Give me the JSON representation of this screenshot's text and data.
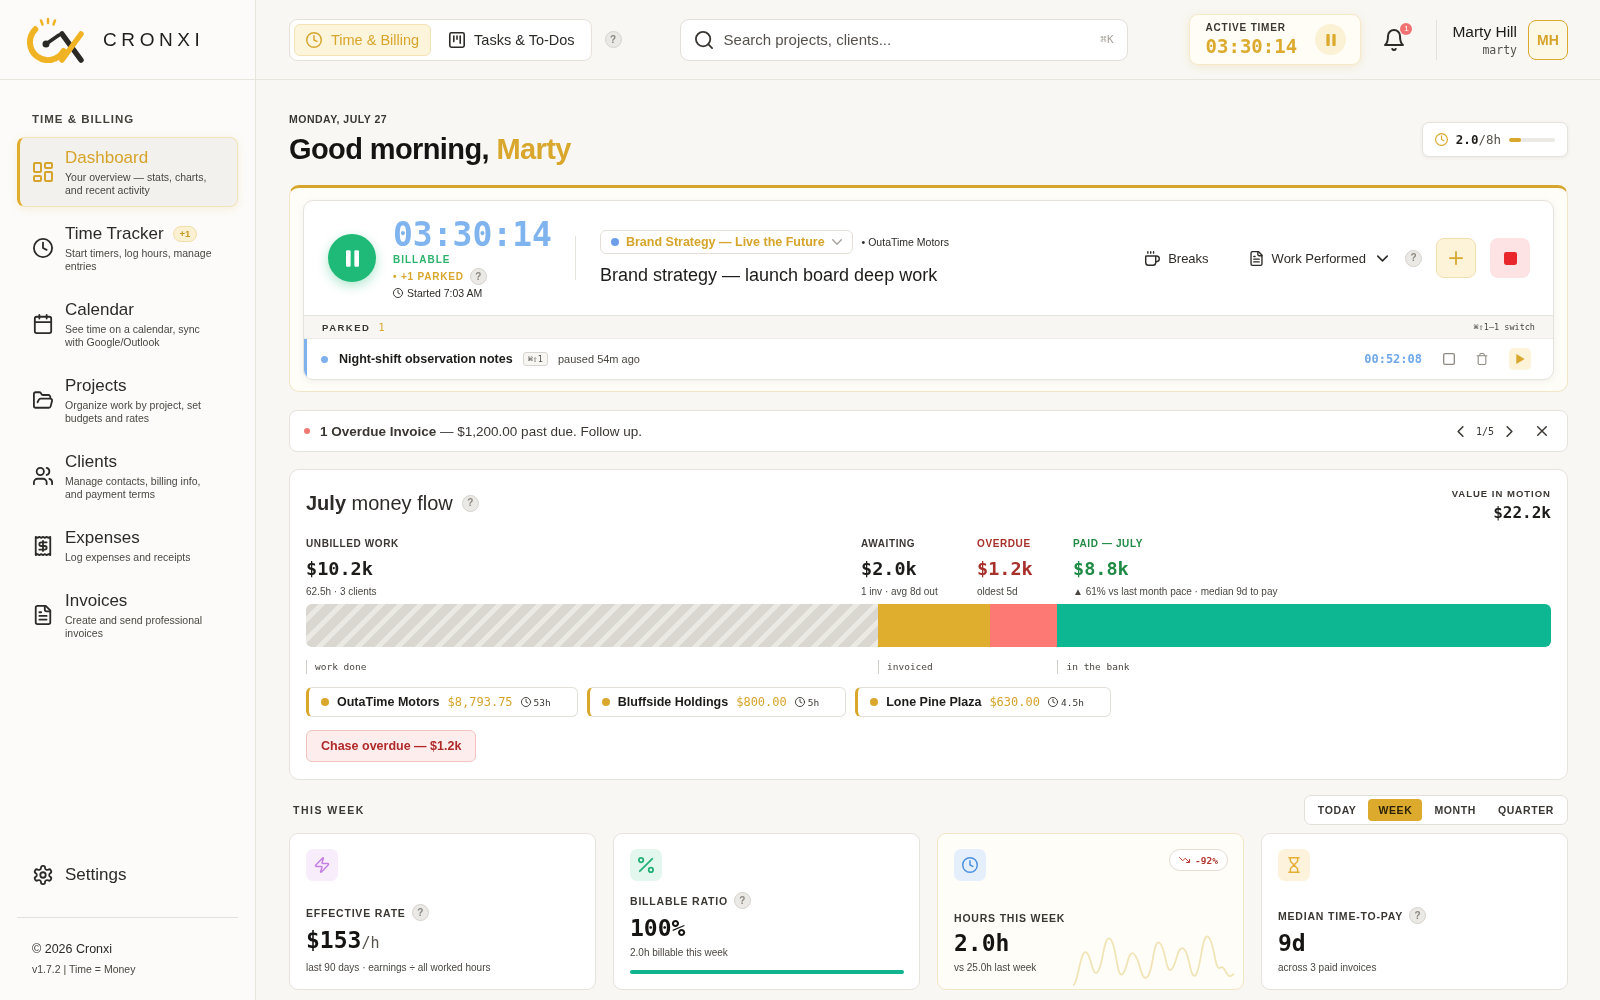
{
  "brand": {
    "name": "CRONXI"
  },
  "sidebar": {
    "section": "TIME & BILLING",
    "items": [
      {
        "title": "Dashboard",
        "description": "Your overview — stats, charts, and recent activity",
        "selected": true
      },
      {
        "title": "Time Tracker",
        "badge": "+1",
        "description": "Start timers, log hours, manage entries",
        "selected": false
      },
      {
        "title": "Calendar",
        "description": "See time on a calendar, sync with Google/Outlook",
        "selected": false
      },
      {
        "title": "Projects",
        "description": "Organize work by project, set budgets and rates",
        "selected": false
      },
      {
        "title": "Clients",
        "description": "Manage contacts, billing info, and payment terms",
        "selected": false
      },
      {
        "title": "Expenses",
        "description": "Log expenses and receipts",
        "selected": false
      },
      {
        "title": "Invoices",
        "description": "Create and send professional invoices",
        "selected": false
      }
    ],
    "settings": "Settings",
    "copyright": "© 2026 Cronxi",
    "version": "v1.7.2 | Time = Money"
  },
  "topbar": {
    "modes": [
      {
        "label": "Time & Billing",
        "selected": true
      },
      {
        "label": "Tasks & To-Dos",
        "selected": false
      }
    ],
    "help": "?",
    "search": {
      "placeholder": "Search projects, clients...",
      "shortcut": "⌘K"
    },
    "active_timer": {
      "label": "ACTIVE TIMER",
      "time": "03:30:14"
    },
    "notifications": "1",
    "user": {
      "name": "Marty Hill",
      "handle": "marty",
      "initials": "MH"
    }
  },
  "header": {
    "date": "MONDAY, JULY 27",
    "greeting": "Good morning,",
    "name": "Marty",
    "goal": {
      "logged": "2.0",
      "target": "/8h",
      "level": 0.25
    }
  },
  "timer": {
    "time": "03:30:14",
    "billable": "BILLABLE",
    "parked": "• +1 PARKED",
    "help": "?",
    "started": "Started 7:03 AM",
    "project": "Brand Strategy — Live the Future",
    "client": "• OutaTime Motors",
    "description": "Brand strategy — launch board deep work",
    "breaks": "Breaks",
    "work_performed": "Work Performed",
    "actions_help": "?",
    "parked_list": {
      "label": "PARKED",
      "count": "1",
      "hint": "⌘⇧1–1 switch",
      "items": [
        {
          "name": "Night-shift observation notes",
          "shortcut": "⌘⇧1",
          "status": "paused 54m ago",
          "time": "00:52:08"
        }
      ]
    }
  },
  "alert": {
    "text": "**1 Overdue Invoice** — $1,200.00 past due. Follow up.",
    "pager": "1/5"
  },
  "money_flow": {
    "title": "**July** money flow",
    "help": "?",
    "total_label": "VALUE IN MOTION",
    "total": "$22.2k",
    "stats": [
      {
        "kind": "unbilled",
        "label": "UNBILLED WORK",
        "value": "$10.2k",
        "note": "62.5h · 3 clients",
        "bar_label": "work done"
      },
      {
        "kind": "awaiting",
        "label": "AWAITING",
        "value": "$2.0k",
        "note": "1 inv · avg 8d out",
        "color": "#e0ae2f",
        "bar_label": "invoiced"
      },
      {
        "kind": "overdue",
        "label": "OVERDUE",
        "value": "$1.2k",
        "note": "oldest 5d",
        "color": "#fc7a73"
      },
      {
        "kind": "paid",
        "label": "PAID — JULY",
        "value": "$8.8k",
        "note": "▲ 61% vs last month pace · median 9d to pay",
        "color": "#0db792",
        "bar_label": "in the bank"
      }
    ],
    "clients": [
      {
        "name": "OutaTime Motors",
        "amount": "$8,793.75",
        "hours": "53h"
      },
      {
        "name": "Bluffside Holdings",
        "amount": "$800.00",
        "hours": "5h"
      },
      {
        "name": "Lone Pine Plaza",
        "amount": "$630.00",
        "hours": "4.5h"
      }
    ],
    "action": "Chase overdue — $1.2k"
  },
  "week": {
    "label": "THIS WEEK",
    "ranges": [
      {
        "label": "TODAY",
        "selected": false
      },
      {
        "label": "WEEK",
        "selected": true
      },
      {
        "label": "MONTH",
        "selected": false
      },
      {
        "label": "QUARTER",
        "selected": false
      }
    ],
    "cards": [
      {
        "kind": "rate",
        "label": "EFFECTIVE RATE",
        "help": "?",
        "value": "$153",
        "unit": "/h",
        "note": "last 90 days · earnings ÷ all worked hours"
      },
      {
        "kind": "ratio",
        "label": "BILLABLE RATIO",
        "help": "?",
        "value": "100%",
        "note": "2.0h billable this week",
        "level": 1
      },
      {
        "kind": "hours",
        "label": "HOURS THIS WEEK",
        "value": "2.0h",
        "note": "vs 25.0h last week",
        "trend": "-92%"
      },
      {
        "kind": "time",
        "label": "MEDIAN TIME-TO-PAY",
        "help": "?",
        "value": "9d",
        "note": "across 3 paid invoices"
      }
    ]
  }
}
